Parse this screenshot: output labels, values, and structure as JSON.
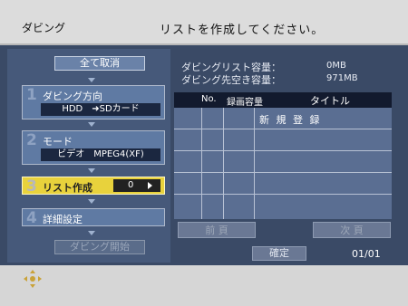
{
  "header": {
    "title": "ダビング",
    "message": "リストを作成してください。"
  },
  "left_panel": {
    "cancel_all_label": "全て取消",
    "steps": [
      {
        "num": "1",
        "label": "ダビング方向",
        "value": "HDD　➜SDカード"
      },
      {
        "num": "2",
        "label": "モード",
        "value": "ビデオ　MPEG4(XF)"
      },
      {
        "num": "3",
        "label": "リスト作成",
        "value": "0"
      },
      {
        "num": "4",
        "label": "詳細設定"
      }
    ],
    "start_label": "ダビング開始"
  },
  "info": {
    "list_capacity_label": "ダビングリスト容量：",
    "list_capacity_value": "0MB",
    "free_capacity_label": "ダビング先空き容量：",
    "free_capacity_value": "971MB"
  },
  "table": {
    "headers": {
      "no": "No.",
      "size": "録画容量",
      "title": "タイトル"
    },
    "new_registration": "新 規 登 録"
  },
  "nav": {
    "prev_label": "前 頁",
    "next_label": "次 頁",
    "confirm_label": "確定",
    "page": "01/01"
  },
  "colors": {
    "highlight": "#e8d23c",
    "panel": "#3a4a66",
    "item": "#5f7aa3"
  },
  "icons": {
    "nav_icon": "dpad-icon"
  }
}
